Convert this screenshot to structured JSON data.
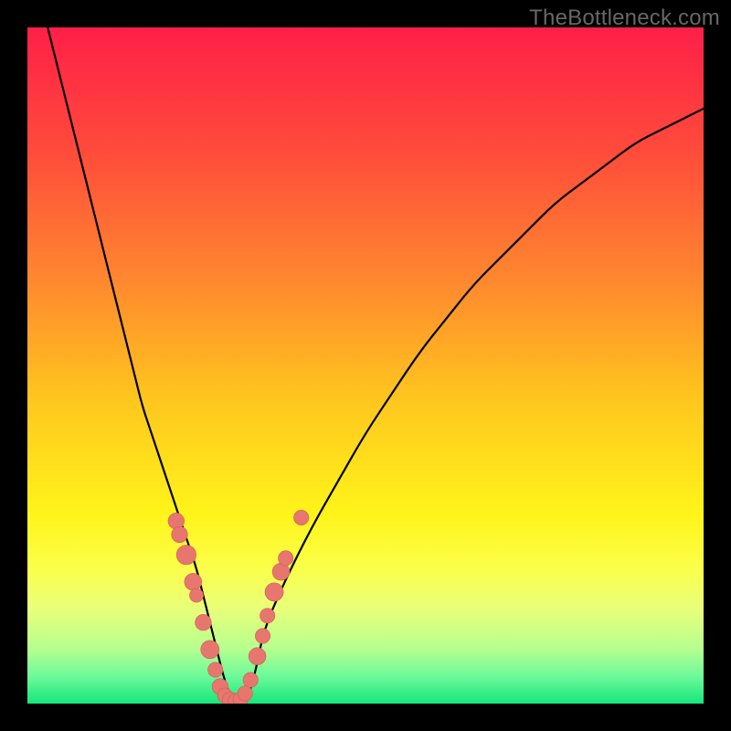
{
  "watermark": "TheBottleneck.com",
  "colors": {
    "frame": "#000000",
    "curve": "#000000",
    "marker_fill": "#e7766f",
    "marker_stroke": "#d45c55",
    "gradient_stops": [
      {
        "offset": 0.0,
        "color": "#ff1f48"
      },
      {
        "offset": 0.18,
        "color": "#ff4a3b"
      },
      {
        "offset": 0.38,
        "color": "#ff8a2e"
      },
      {
        "offset": 0.55,
        "color": "#ffc61e"
      },
      {
        "offset": 0.72,
        "color": "#fff41a"
      },
      {
        "offset": 0.8,
        "color": "#fbff4a"
      },
      {
        "offset": 0.86,
        "color": "#e8ff7a"
      },
      {
        "offset": 0.92,
        "color": "#b4ff8f"
      },
      {
        "offset": 0.96,
        "color": "#6cf99a"
      },
      {
        "offset": 1.0,
        "color": "#14e87a"
      }
    ]
  },
  "chart_data": {
    "type": "line",
    "title": "",
    "xlabel": "",
    "ylabel": "",
    "xlim": [
      0,
      100
    ],
    "ylim": [
      0,
      100
    ],
    "x": [
      3,
      4,
      5,
      6,
      7,
      8,
      9,
      10,
      11,
      12,
      13,
      14,
      15,
      16,
      17,
      18,
      19,
      20,
      21,
      22,
      23,
      24,
      25,
      26,
      27,
      28,
      29,
      30,
      31,
      32,
      33,
      34,
      35,
      38,
      42,
      46,
      50,
      54,
      58,
      62,
      66,
      70,
      74,
      78,
      82,
      86,
      90,
      94,
      98,
      100
    ],
    "values": [
      100,
      96,
      92,
      88,
      84,
      80,
      76,
      72,
      68,
      64,
      60,
      56,
      52,
      48,
      44,
      41,
      38,
      35,
      32,
      29,
      26,
      23,
      20,
      16,
      12,
      8,
      4,
      1,
      0,
      0,
      2,
      6,
      11,
      18,
      26,
      33,
      40,
      46,
      52,
      57,
      62,
      66,
      70,
      74,
      77,
      80,
      83,
      85,
      87,
      88
    ],
    "series": [
      {
        "name": "bottleneck-curve",
        "x": [
          3,
          4,
          5,
          6,
          7,
          8,
          9,
          10,
          11,
          12,
          13,
          14,
          15,
          16,
          17,
          18,
          19,
          20,
          21,
          22,
          23,
          24,
          25,
          26,
          27,
          28,
          29,
          30,
          31,
          32,
          33,
          34,
          35,
          38,
          42,
          46,
          50,
          54,
          58,
          62,
          66,
          70,
          74,
          78,
          82,
          86,
          90,
          94,
          98,
          100
        ],
        "y": [
          100,
          96,
          92,
          88,
          84,
          80,
          76,
          72,
          68,
          64,
          60,
          56,
          52,
          48,
          44,
          41,
          38,
          35,
          32,
          29,
          26,
          23,
          20,
          16,
          12,
          8,
          4,
          1,
          0,
          0,
          2,
          6,
          11,
          18,
          26,
          33,
          40,
          46,
          52,
          57,
          62,
          66,
          70,
          74,
          77,
          80,
          83,
          85,
          87,
          88
        ]
      }
    ],
    "markers": [
      {
        "x": 22,
        "y": 27,
        "r": 1.4
      },
      {
        "x": 22.5,
        "y": 25,
        "r": 1.4
      },
      {
        "x": 23.5,
        "y": 22,
        "r": 1.7
      },
      {
        "x": 24.5,
        "y": 18,
        "r": 1.5
      },
      {
        "x": 25,
        "y": 16,
        "r": 1.2
      },
      {
        "x": 26,
        "y": 12,
        "r": 1.4
      },
      {
        "x": 27,
        "y": 8,
        "r": 1.6
      },
      {
        "x": 27.8,
        "y": 5,
        "r": 1.3
      },
      {
        "x": 28.5,
        "y": 2.5,
        "r": 1.4
      },
      {
        "x": 29.2,
        "y": 1.2,
        "r": 1.3
      },
      {
        "x": 30,
        "y": 0.5,
        "r": 1.4
      },
      {
        "x": 30.8,
        "y": 0.4,
        "r": 1.3
      },
      {
        "x": 31.5,
        "y": 0.6,
        "r": 1.3
      },
      {
        "x": 32.2,
        "y": 1.5,
        "r": 1.3
      },
      {
        "x": 33,
        "y": 3.5,
        "r": 1.3
      },
      {
        "x": 34,
        "y": 7,
        "r": 1.5
      },
      {
        "x": 34.8,
        "y": 10,
        "r": 1.3
      },
      {
        "x": 35.5,
        "y": 13,
        "r": 1.3
      },
      {
        "x": 36.5,
        "y": 16.5,
        "r": 1.6
      },
      {
        "x": 37.5,
        "y": 19.5,
        "r": 1.5
      },
      {
        "x": 38.2,
        "y": 21.5,
        "r": 1.3
      },
      {
        "x": 40.5,
        "y": 27.5,
        "r": 1.3
      }
    ]
  }
}
